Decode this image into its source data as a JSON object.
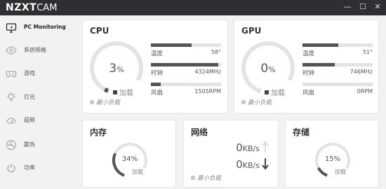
{
  "app": {
    "brand": "NZXT",
    "product": "CAM"
  },
  "window": {
    "minimize": "—",
    "maximize": "☐",
    "close": "✕"
  },
  "sidebar": {
    "items": [
      {
        "label": "PC Monitoring",
        "icon": "monitor-icon"
      },
      {
        "label": "系统规格",
        "icon": "eye-icon"
      },
      {
        "label": "游戏",
        "icon": "gamepad-icon"
      },
      {
        "label": "灯光",
        "icon": "lightbulb-icon"
      },
      {
        "label": "超频",
        "icon": "speedometer-icon"
      },
      {
        "label": "散热",
        "icon": "fan-icon"
      },
      {
        "label": "功率",
        "icon": "power-icon"
      }
    ]
  },
  "cpu": {
    "title": "CPU",
    "load_value": "3",
    "load_unit": "%",
    "load_label": "加载",
    "load_fraction": 0.03,
    "min_load": "最小负载",
    "metrics": [
      {
        "label": "温度",
        "value": "58°",
        "fraction": 0.58
      },
      {
        "label": "时钟",
        "value": "4324MHz",
        "fraction": 0.96
      },
      {
        "label": "风扇",
        "value": "1505RPM",
        "fraction": 0.14
      }
    ]
  },
  "gpu": {
    "title": "GPU",
    "load_value": "0",
    "load_unit": "%",
    "load_label": "加载",
    "load_fraction": 0.0,
    "min_load": "最小负载",
    "metrics": [
      {
        "label": "温度",
        "value": "51°",
        "fraction": 0.51
      },
      {
        "label": "时钟",
        "value": "746MHz",
        "fraction": 0.46
      },
      {
        "label": "风扇",
        "value": "0RPM",
        "fraction": 0.0
      }
    ]
  },
  "memory": {
    "title": "内存",
    "value": "34%",
    "label": "加载",
    "fraction": 0.34
  },
  "network": {
    "title": "网络",
    "upload_value": "0",
    "download_value": "0",
    "unit": "KB/s",
    "min_load": "最小负载"
  },
  "storage": {
    "title": "存储",
    "value": "15%",
    "label": "加载",
    "fraction": 0.15
  },
  "colors": {
    "titlebar": "#2f2e33",
    "accent": "#555555",
    "track": "#e3e3e3",
    "background": "#f2f2f2"
  }
}
